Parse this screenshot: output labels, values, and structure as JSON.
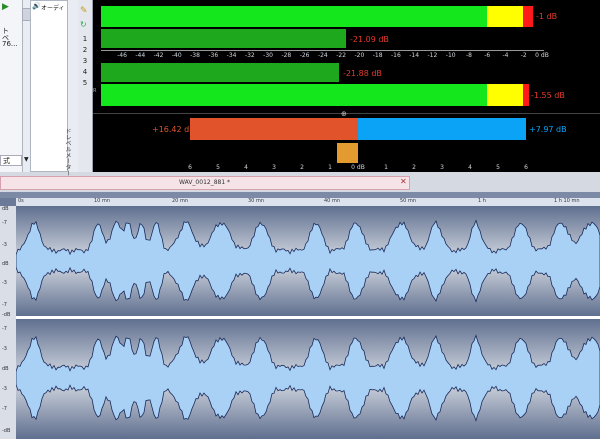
{
  "left_panel": {
    "tree_items": [
      "ト",
      "ベ",
      "76..."
    ],
    "audio_tab_label": "オーディ",
    "format_label": "式",
    "vertical_tab": "ドレベルメーター",
    "tool_numbers": [
      "1",
      "2",
      "3",
      "4",
      "5"
    ],
    "channel_letter": "R"
  },
  "meters": {
    "rows": [
      {
        "id": "1",
        "level_db": -1.0,
        "label": "-1 dB",
        "type": "peak"
      },
      {
        "id": "2",
        "level_db": -21.09,
        "label": "-21.09 dB",
        "type": "rms"
      },
      {
        "id": "4",
        "level_db": -21.88,
        "label": "-21.88 dB",
        "type": "rms"
      },
      {
        "id": "5",
        "level_db": -1.55,
        "label": "-1.55 dB",
        "type": "peak"
      }
    ],
    "scale_ticks": [
      "-46",
      "-44",
      "-42",
      "-40",
      "-38",
      "-36",
      "-34",
      "-32",
      "-30",
      "-28",
      "-26",
      "-24",
      "-22",
      "-20",
      "-18",
      "-16",
      "-14",
      "-12",
      "-10",
      "-8",
      "-6",
      "-4",
      "-2",
      "0 dB"
    ],
    "balance": {
      "left_label": "+16.42 dB",
      "right_label": "+7.97 dB",
      "scale": [
        "6",
        "5",
        "4",
        "3",
        "2",
        "1",
        "0 dB",
        "1",
        "2",
        "3",
        "4",
        "5",
        "6"
      ]
    },
    "colors": {
      "green": "#14e81c",
      "yellow": "#ffff00",
      "red": "#ff1a1a",
      "balance_left": "#e0532b",
      "balance_right": "#0aa3f5",
      "orange": "#e39a2e"
    }
  },
  "wave_window": {
    "title": "WAV_0012_881 *",
    "close": "✕",
    "ruler": [
      "0s",
      "10 mn",
      "20 mn",
      "30 mn",
      "40 mn",
      "50 mn",
      "1 h",
      "1 h 10 mn"
    ],
    "y_labels_top": [
      "dB",
      "-7",
      "-3",
      "dB",
      "-3",
      "-7",
      "-dB"
    ],
    "y_labels_bottom": [
      "-7",
      "-3",
      "dB",
      "-3",
      "-7",
      "-dB"
    ]
  }
}
